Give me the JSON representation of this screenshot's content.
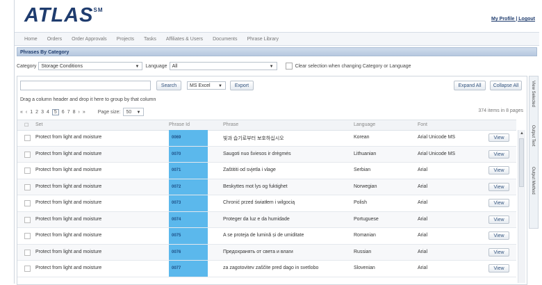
{
  "app": {
    "logo": "ATLAS",
    "logo_mark": "SM",
    "top_links": "My Profile | Logout"
  },
  "nav": [
    "Home",
    "Orders",
    "Order Approvals",
    "Projects",
    "Tasks",
    "Affiliates & Users",
    "Documents",
    "Phrase Library"
  ],
  "section_title": "Phrases By Category",
  "filters": {
    "category_label": "Category",
    "category_value": "Storage Conditions",
    "language_label": "Language",
    "language_value": "All",
    "clear_label": "Clear selection when changing Category or Language"
  },
  "toolbar": {
    "search_placeholder": "",
    "search_label": "Search",
    "export_format": "MS Excel",
    "export_label": "Export",
    "expand_label": "Expand All",
    "collapse_label": "Collapse All"
  },
  "group_hint": "Drag a column header and drop it here to group by that column",
  "pager": {
    "nav_first": "«",
    "nav_prev": "‹",
    "pages": [
      "1",
      "2",
      "3",
      "4",
      "5",
      "6",
      "7",
      "8"
    ],
    "current": "5",
    "nav_next": "›",
    "nav_last": "»",
    "page_size_label": "Page size:",
    "page_size": "50",
    "items_text": "374 items in 8 pages"
  },
  "columns": [
    "Set",
    "Phrase Id",
    "Phrase",
    "Language",
    "Font"
  ],
  "rows": [
    {
      "set": "Protect from light and moisture",
      "id": "0069",
      "phrase": "빛과 습기로부터 보호하십시오",
      "language": "Korean",
      "font": "Arial Unicode MS",
      "action": "View"
    },
    {
      "set": "Protect from light and moisture",
      "id": "0070",
      "phrase": "Saugoti nuo šviesos ir drėgmės",
      "language": "Lithuanian",
      "font": "Arial Unicode MS",
      "action": "View"
    },
    {
      "set": "Protect from light and moisture",
      "id": "0071",
      "phrase": "Zaštititi od svjetla i vlage",
      "language": "Serbian",
      "font": "Arial",
      "action": "View"
    },
    {
      "set": "Protect from light and moisture",
      "id": "0072",
      "phrase": "Beskyttes mot lys og fuktighet",
      "language": "Norwegian",
      "font": "Arial",
      "action": "View"
    },
    {
      "set": "Protect from light and moisture",
      "id": "0073",
      "phrase": "Chronić przed światłem i wilgocią",
      "language": "Polish",
      "font": "Arial",
      "action": "View"
    },
    {
      "set": "Protect from light and moisture",
      "id": "0074",
      "phrase": "Proteger da luz e da humidade",
      "language": "Portuguese",
      "font": "Arial",
      "action": "View"
    },
    {
      "set": "Protect from light and moisture",
      "id": "0075",
      "phrase": "A se proteja de lumină și de umiditate",
      "language": "Romanian",
      "font": "Arial",
      "action": "View"
    },
    {
      "set": "Protect from light and moisture",
      "id": "0076",
      "phrase": "Предохранять от света и влаги",
      "language": "Russian",
      "font": "Arial",
      "action": "View"
    },
    {
      "set": "Protect from light and moisture",
      "id": "0077",
      "phrase": "za zagotovitev zaščite pred dago in svetlobo",
      "language": "Slovenian",
      "font": "Arial",
      "action": "View"
    }
  ],
  "side_tabs": [
    "View Selected",
    "Output Text",
    "Output Method"
  ]
}
